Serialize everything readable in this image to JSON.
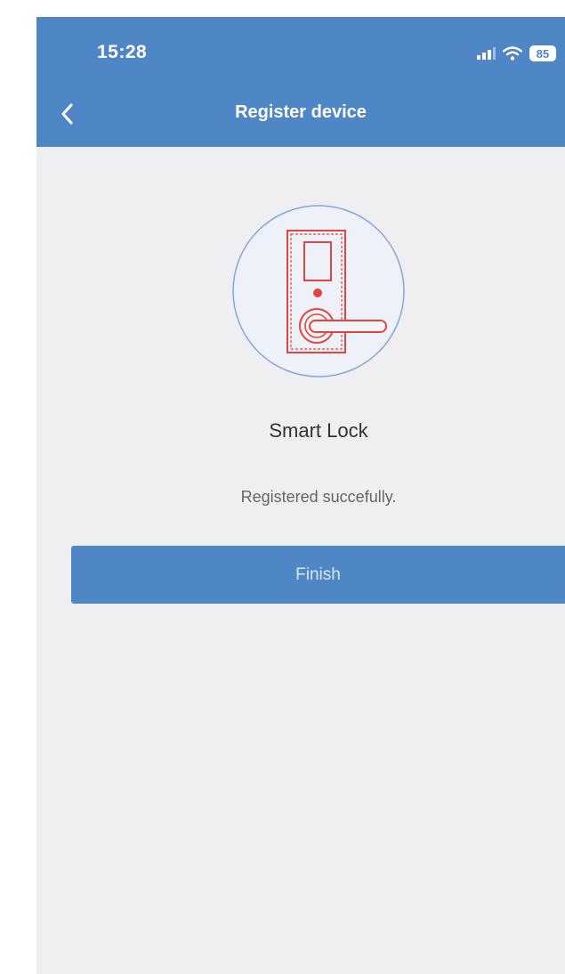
{
  "status_bar": {
    "time": "15:28",
    "battery": "85",
    "icons": [
      "cellular-signal-icon",
      "wifi-icon",
      "battery-icon"
    ]
  },
  "header": {
    "title": "Register device",
    "back_icon": "chevron-left-icon"
  },
  "device": {
    "icon": "smart-lock-icon",
    "name": "Smart Lock",
    "message": "Registered succefully."
  },
  "actions": {
    "finish_label": "Finish"
  },
  "colors": {
    "header": "#4f86c6",
    "background": "#efeff2",
    "lock_icon": "#e0463f",
    "circle_outline": "#7fa9dc",
    "button": "#4f86c6"
  }
}
